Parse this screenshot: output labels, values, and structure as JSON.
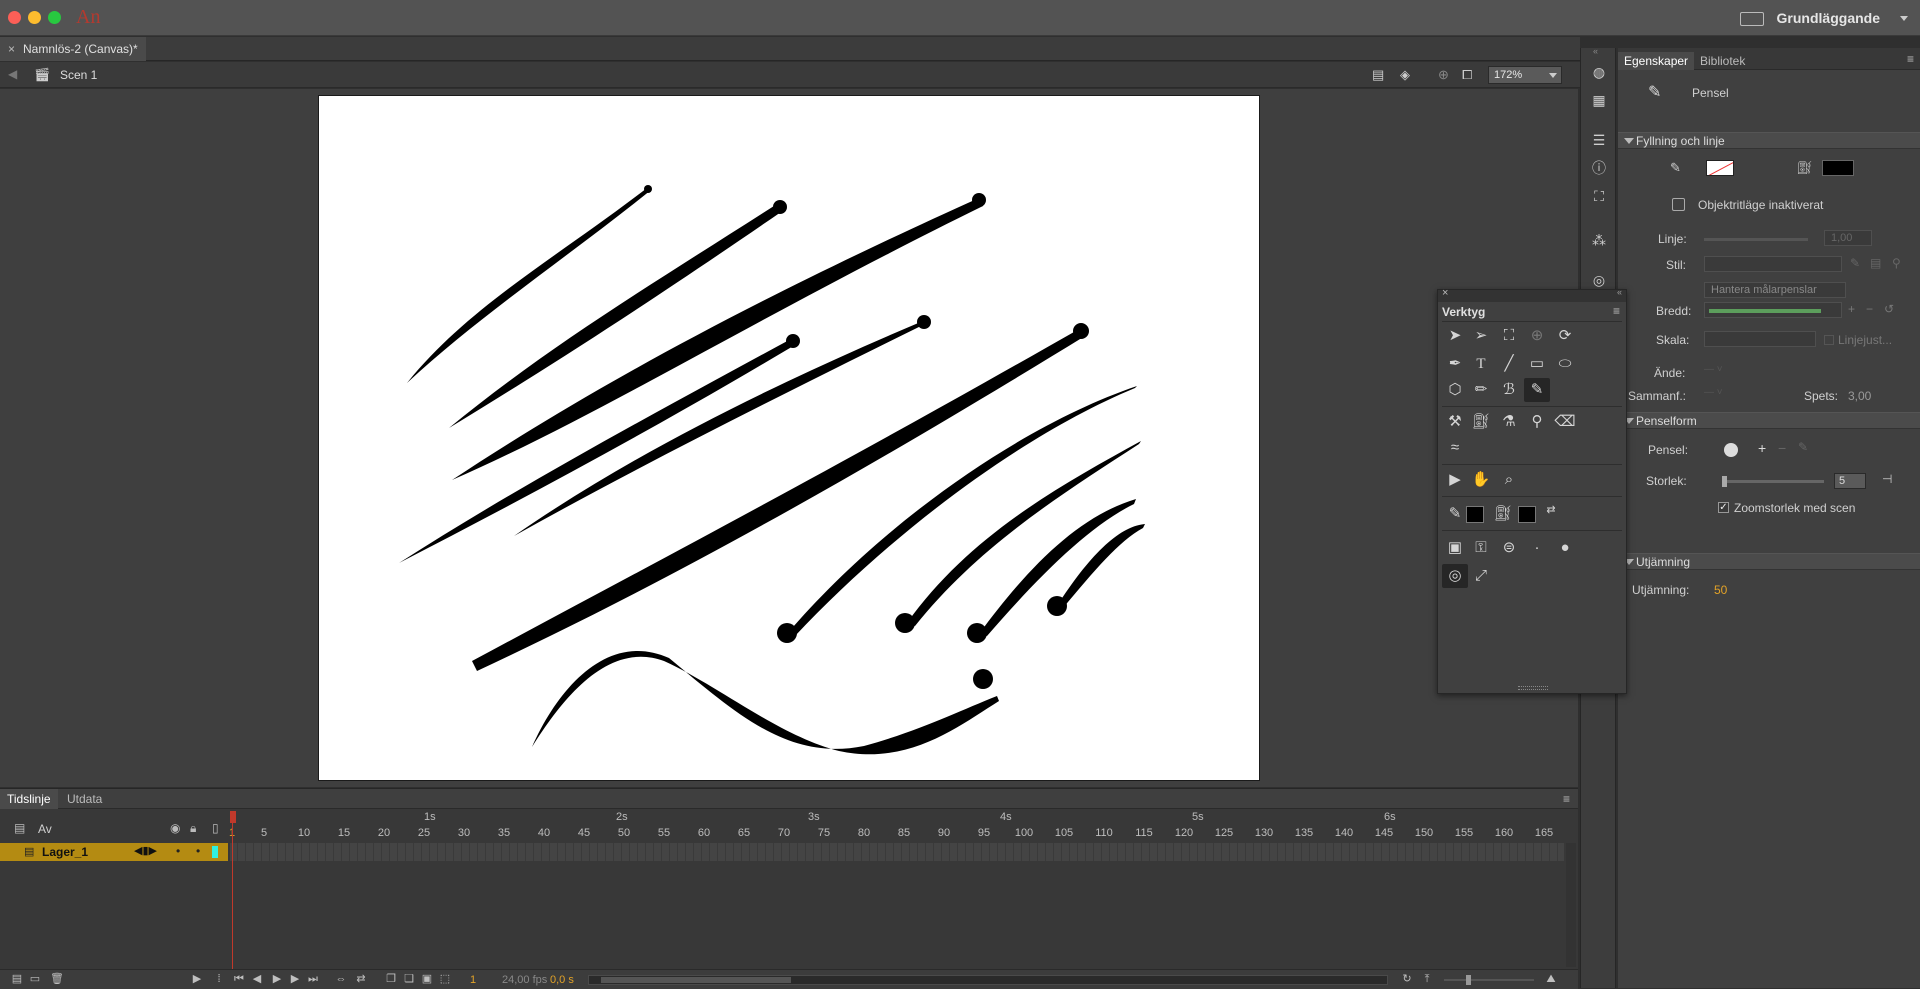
{
  "app": {
    "logo": "An",
    "workspace": "Grundläggande"
  },
  "document": {
    "tab_title": "Namnlös-2 (Canvas)*"
  },
  "scene": {
    "name": "Scen 1",
    "zoom": "172%"
  },
  "properties": {
    "tabs": [
      "Egenskaper",
      "Bibliotek"
    ],
    "tool_name": "Pensel",
    "fill_stroke": {
      "title": "Fyllning och linje",
      "object_mode": "Objektritläge inaktiverat",
      "line_label": "Linje:",
      "line_value": "1,00",
      "style_label": "Stil:",
      "manage_brushes": "Hantera målarpenslar",
      "width_label": "Bredd:",
      "scale_label": "Skala:",
      "hinting_label": "Linjejust...",
      "cap_label": "Ände:",
      "join_label": "Sammanf.:",
      "tip_label": "Spets:",
      "tip_value": "3,00"
    },
    "brush_shape": {
      "title": "Penselform",
      "brush_label": "Pensel:",
      "size_label": "Storlek:",
      "size_value": "5",
      "zoom_size_label": "Zoomstorlek med scen",
      "zoom_size_checked": true
    },
    "smoothing": {
      "title": "Utjämning",
      "label": "Utjämning:",
      "value": "50"
    }
  },
  "tools": {
    "title": "Verktyg"
  },
  "timeline": {
    "tabs": [
      "Tidslinje",
      "Utdata"
    ],
    "layers": [
      {
        "name": "Av"
      },
      {
        "name": "Lager_1"
      }
    ],
    "frame_numbers": [
      "1",
      "5",
      "10",
      "15",
      "20",
      "25",
      "30",
      "35",
      "40",
      "45",
      "50",
      "55",
      "60",
      "65",
      "70",
      "75",
      "80",
      "85",
      "90",
      "95",
      "100",
      "105",
      "110",
      "115",
      "120",
      "125",
      "130",
      "135",
      "140",
      "145",
      "150",
      "155",
      "160",
      "165"
    ],
    "seconds": [
      "1s",
      "2s",
      "3s",
      "4s",
      "5s",
      "6s"
    ],
    "current_frame": "1",
    "fps": "24,00 fps",
    "time": "0,0 s"
  },
  "colors": {
    "accent": "#b48b12",
    "playhead": "#c0392b",
    "smoothing": "#e2a227"
  }
}
